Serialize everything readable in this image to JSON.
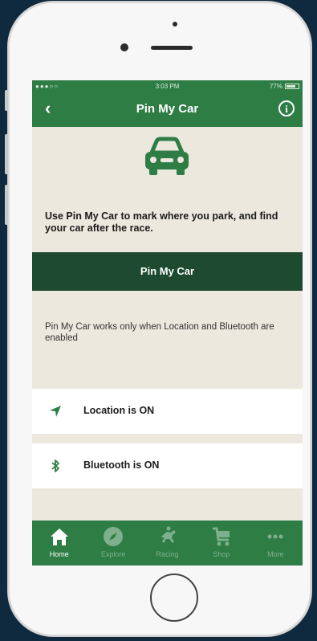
{
  "status_bar": {
    "signal": "●●●○○",
    "time": "3:03 PM",
    "battery_text": "77%",
    "battery_level": 0.77
  },
  "nav": {
    "title": "Pin My Car",
    "back_icon": "chevron-left-icon",
    "info_icon": "info-icon"
  },
  "hero": {
    "icon": "car-icon",
    "description": "Use Pin My Car to mark where you park, and find your car after the race."
  },
  "primary_button": {
    "label": "Pin My Car"
  },
  "note": "Pin My Car works only when Location and Bluetooth are enabled",
  "status_rows": [
    {
      "icon": "location-arrow-icon",
      "label": "Location is ON"
    },
    {
      "icon": "bluetooth-icon",
      "label": "Bluetooth is ON"
    }
  ],
  "tabs": [
    {
      "label": "Home",
      "icon": "home-icon",
      "active": true
    },
    {
      "label": "Explore",
      "icon": "compass-icon",
      "active": false
    },
    {
      "label": "Racing",
      "icon": "horse-racing-icon",
      "active": false
    },
    {
      "label": "Shop",
      "icon": "cart-icon",
      "active": false
    },
    {
      "label": "More",
      "icon": "more-dots-icon",
      "active": false
    }
  ],
  "colors": {
    "brand_green": "#2e7d45",
    "dark_green": "#1d4a30",
    "background": "#ede8dd",
    "inactive_tab": "#7fb08d"
  }
}
